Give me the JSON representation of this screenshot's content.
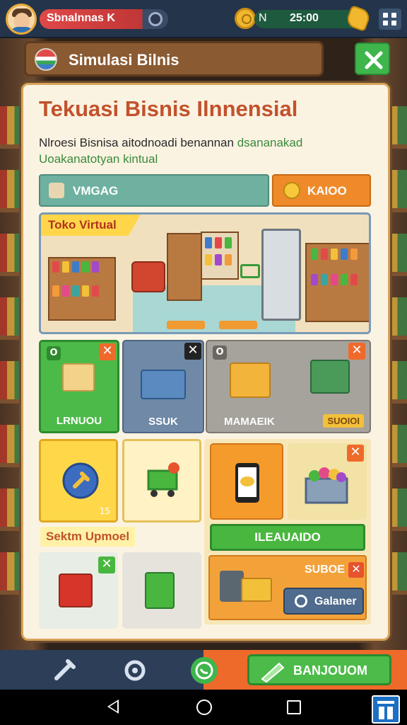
{
  "topbar": {
    "player_name": "Sbnalnnas K",
    "currency_label": "N",
    "currency_value": "25:00",
    "icons": [
      "avatar",
      "toggle-icon",
      "coin-icon",
      "gem-icon",
      "grid-menu-icon"
    ]
  },
  "header": {
    "title": "Simulasi Bilnis",
    "close_icon": "close-icon"
  },
  "panel": {
    "title": "Tekuasi Bisnis Ilnnensial",
    "description_line1_dark": "Nlroesi Bisnisa aitodnoadi benannan ",
    "description_line1_green": "dsananakad",
    "description_line2": "Uoakanatotyan kintual",
    "btn_left_label": "VMGAG",
    "btn_right_label": "KAIOO",
    "store_tag": "Toko Virtual"
  },
  "tiles": {
    "tile1_chip": "O",
    "tile1_caption": "LRNUOU",
    "tile2_caption": "SSUK",
    "tile3_chip": "O",
    "tile3_caption": "MAMAEIK",
    "tile3_badge": "SUOIOI",
    "tile4_number": "15",
    "close_mark": "✕",
    "check_mark": "✓"
  },
  "upgrade": {
    "label": "Sektm Upmoel",
    "green_bar_label": "ILEAUAIDO",
    "subsection_label": "SUBOE",
    "cancel_label": "Galaner"
  },
  "bottom_nav": {
    "icons": [
      "pen-icon",
      "settings-icon",
      "whatsapp-icon"
    ],
    "cta_label": "BANJOUOM"
  },
  "colors": {
    "accent_orange": "#ef8a2a",
    "accent_green": "#4cba49",
    "title_red": "#c1522c",
    "panel_bg": "#fbf3e2",
    "topbar_bg": "#24344a"
  }
}
